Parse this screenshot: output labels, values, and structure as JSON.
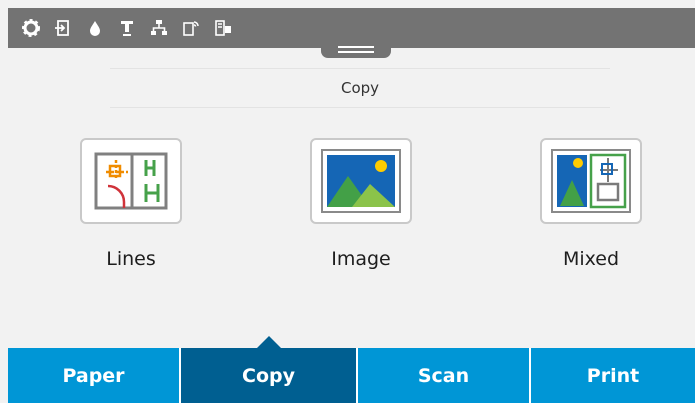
{
  "status_bar": {
    "icons": [
      "settings-icon",
      "paper-load-icon",
      "ink-drop-icon",
      "printhead-icon",
      "network-icon",
      "wireless-direct-icon",
      "printer-connectivity-icon"
    ]
  },
  "screen": {
    "title": "Copy"
  },
  "options": [
    {
      "label": "Lines",
      "icon": "lines-plan-icon"
    },
    {
      "label": "Image",
      "icon": "image-landscape-icon"
    },
    {
      "label": "Mixed",
      "icon": "mixed-content-icon"
    }
  ],
  "tabs": [
    {
      "label": "Paper",
      "active": false
    },
    {
      "label": "Copy",
      "active": true
    },
    {
      "label": "Scan",
      "active": false
    },
    {
      "label": "Print",
      "active": false
    }
  ],
  "colors": {
    "tab_bar": "#0096d6",
    "tab_active": "#005f91",
    "status_bar": "#737373",
    "background": "#f2f2f2"
  }
}
